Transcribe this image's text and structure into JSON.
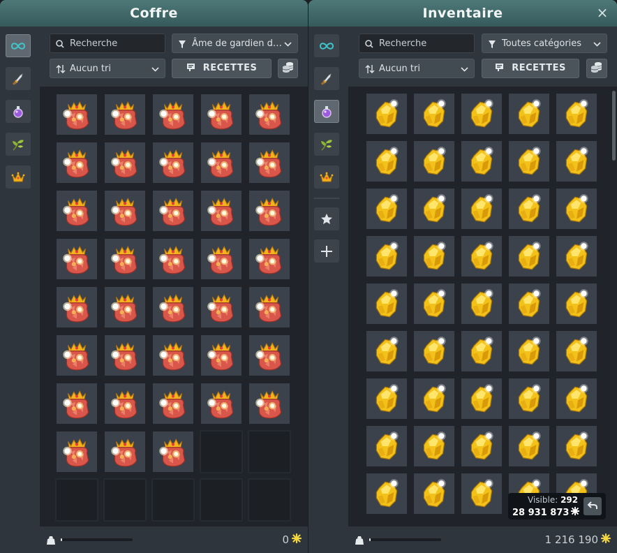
{
  "chest": {
    "title": "Coffre",
    "search_placeholder": "Recherche",
    "filter_value": "Âme de gardien d…",
    "sort_value": "Aucun tri",
    "recipes_label": "RECETTES",
    "kamas": "0",
    "weight_fraction": 0.02,
    "tabs": [
      "all-icon",
      "equipment-icon",
      "consumable-icon",
      "resource-icon",
      "crown-icon"
    ],
    "active_tab": 0,
    "items": {
      "name": "guardian-soul-icon",
      "filled": 38,
      "total": 45,
      "columns": 5
    }
  },
  "inventory": {
    "title": "Inventaire",
    "close_glyph": "×",
    "search_placeholder": "Recherche",
    "filter_value": "Toutes catégories",
    "sort_value": "Aucun tri",
    "recipes_label": "RECETTES",
    "kamas": "1 216 190",
    "weight_fraction": 0.02,
    "tabs": [
      "all-icon",
      "equipment-icon",
      "consumable-icon",
      "resource-icon",
      "crown-icon",
      "favorite-star-icon",
      "add-tab-icon"
    ],
    "active_tab": 2,
    "items": {
      "name": "gold-nugget-icon",
      "rows_visible": 9,
      "columns": 5
    }
  },
  "tooltip": {
    "visible_label": "Visible:",
    "visible_count": "292",
    "value": "28 931 873"
  },
  "colors": {
    "title_bar": "#436b6c",
    "panel": "#2a3038",
    "slot": "#3b424b",
    "accent_gold": "#f3c21a",
    "soul_red": "#d8564a"
  }
}
